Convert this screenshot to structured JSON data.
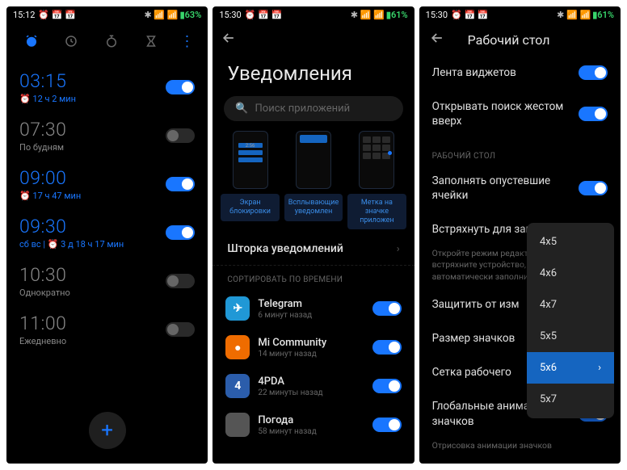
{
  "s1": {
    "time": "15:12",
    "batt": "63",
    "alarms": [
      {
        "time": "03:15",
        "sub": "⏰ 12 ч 2 мин",
        "on": true
      },
      {
        "time": "07:30",
        "sub": "По будням",
        "on": false
      },
      {
        "time": "09:00",
        "sub": "⏰ 17 ч 47 мин",
        "on": true
      },
      {
        "time": "09:30",
        "sub": "сб вс | ⏰ 3 д 18 ч 17 мин",
        "on": true
      },
      {
        "time": "10:30",
        "sub": "Однократно",
        "on": false
      },
      {
        "time": "11:00",
        "sub": "Ежедневно",
        "on": false
      }
    ]
  },
  "s2": {
    "time": "15:30",
    "batt": "61",
    "title": "Уведомления",
    "search_ph": "Поиск приложений",
    "previews": [
      {
        "label": "Экран блокировки"
      },
      {
        "label": "Всплывающие уведомлен"
      },
      {
        "label": "Метка на значке приложен"
      }
    ],
    "section": "Шторка уведомлений",
    "sort_label": "СОРТИРОВАТЬ ПО ВРЕМЕНИ",
    "apps": [
      {
        "name": "Telegram",
        "sub": "6 минут назад",
        "bg": "#2098d6",
        "glyph": "✈"
      },
      {
        "name": "Mi Community",
        "sub": "14 минут назад",
        "bg": "#ef6c00",
        "glyph": "●"
      },
      {
        "name": "4PDA",
        "sub": "22 минуты назад",
        "bg": "#2b5dab",
        "glyph": "4"
      },
      {
        "name": "Погода",
        "sub": "58 минут назад",
        "bg": "#555",
        "glyph": ""
      }
    ]
  },
  "s3": {
    "time": "15:30",
    "batt": "61",
    "title": "Рабочий стол",
    "rows": {
      "widgets": "Лента виджетов",
      "swipe_search": "Открывать поиск жестом вверх",
      "fill_empty": "Заполнять опустевшие ячейки",
      "shake_title": "Встряхнуть для заполнения",
      "shake_desc": "Откройте режим редактирования и встряхните устройство, чтобы автоматически заполнить пустые ячейки.",
      "protect": "Защитить от изм",
      "icon_size": "Размер значков",
      "grid": "Сетка рабочего",
      "anim_title": "Глобальные анимации значков",
      "anim_desc": "Отрисовка анимации значков"
    },
    "section_cap": "РАБОЧИЙ СТОЛ",
    "popup": [
      "4x5",
      "4x6",
      "4x7",
      "5x5",
      "5x6",
      "5x7"
    ],
    "popup_selected": "5x6"
  }
}
